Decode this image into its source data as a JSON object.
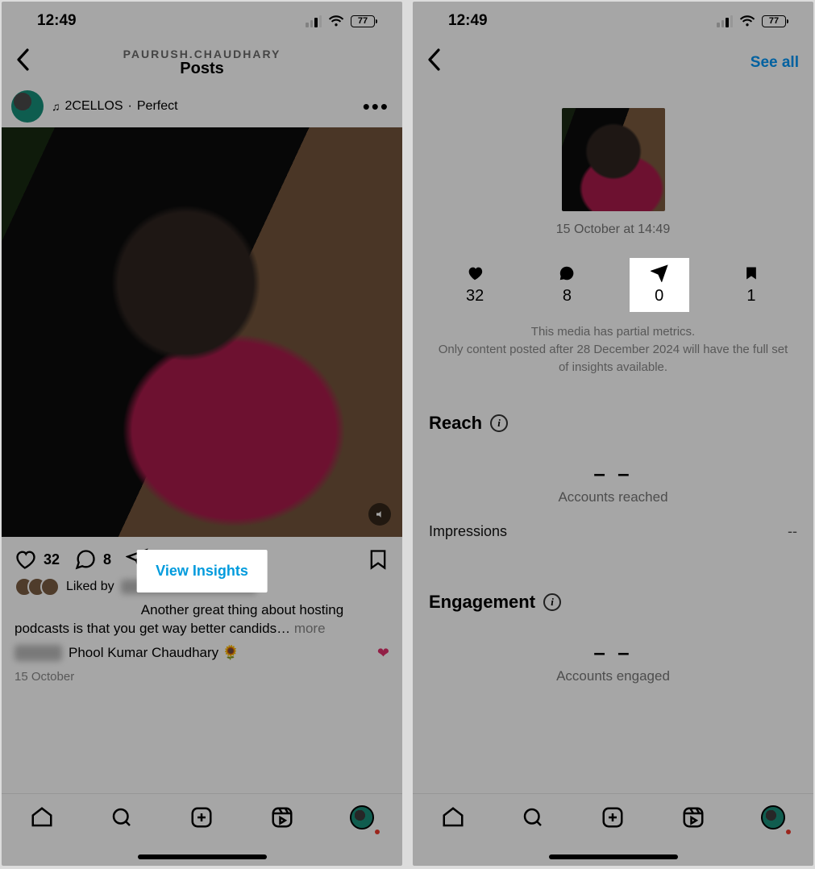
{
  "status": {
    "time": "12:49",
    "battery": "77"
  },
  "screen1": {
    "header": {
      "subtitle": "PAURUSH.CHAUDHARY",
      "title": "Posts"
    },
    "music": {
      "artist": "2CELLOS",
      "sep": "·",
      "track": "Perfect"
    },
    "insights_button": "View Insights",
    "actions": {
      "likes": "32",
      "comments": "8"
    },
    "liked_by_prefix": "Liked by",
    "caption_line1": "Another great thing about hosting",
    "caption_line2": "podcasts is that you get way better candids…",
    "caption_more": "more",
    "commenter": "Phool Kumar Chaudhary 🌻",
    "post_date": "15 October"
  },
  "screen2": {
    "see_all": "See all",
    "thumb_date": "15 October at 14:49",
    "stats": {
      "likes": "32",
      "comments": "8",
      "shares": "0",
      "saves": "1"
    },
    "partial_l1": "This media has partial metrics.",
    "partial_l2": "Only content posted after 28 December 2024 will have the full set of insights available.",
    "reach": {
      "title": "Reach",
      "value": "– –",
      "label": "Accounts reached",
      "impressions_label": "Impressions",
      "impressions_value": "--"
    },
    "engagement": {
      "title": "Engagement",
      "value": "– –",
      "label": "Accounts engaged"
    }
  }
}
